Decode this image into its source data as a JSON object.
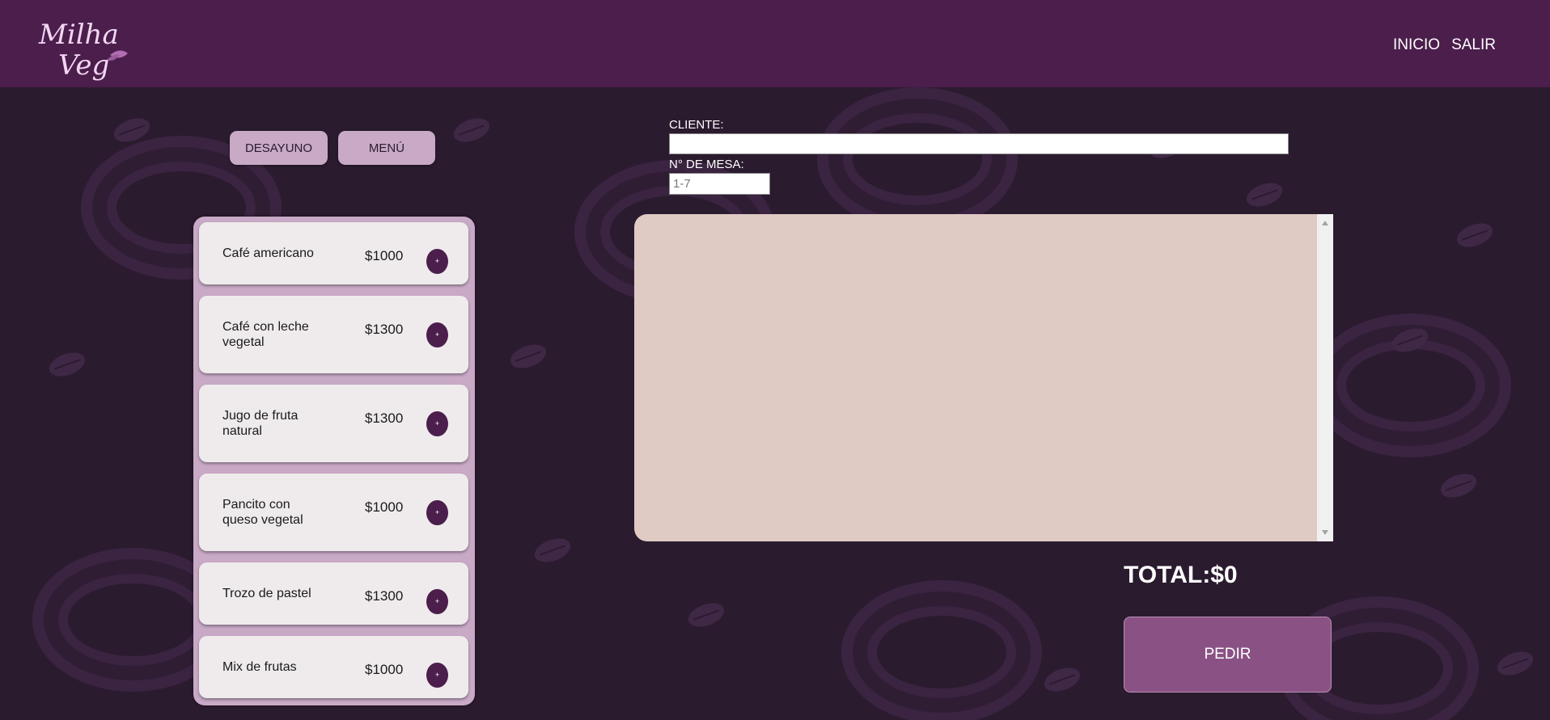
{
  "header": {
    "logo_text_line1": "Milha",
    "logo_text_line2": "Veg",
    "nav": {
      "inicio": "INICIO",
      "salir": "SALIR"
    }
  },
  "categories": {
    "desayuno": "DESAYUNO",
    "menu": "MENÚ"
  },
  "menu_items": [
    {
      "name": "Café americano",
      "price": "$1000",
      "add": "+"
    },
    {
      "name": "Café con leche vegetal",
      "price": "$1300",
      "add": "+"
    },
    {
      "name": "Jugo de fruta natural",
      "price": "$1300",
      "add": "+"
    },
    {
      "name": "Pancito con queso vegetal",
      "price": "$1000",
      "add": "+"
    },
    {
      "name": "Trozo de pastel",
      "price": "$1300",
      "add": "+"
    },
    {
      "name": "Mix de frutas",
      "price": "$1000",
      "add": "+"
    }
  ],
  "form": {
    "cliente_label": "CLIENTE:",
    "cliente_value": "",
    "mesa_label": "N° DE MESA:",
    "mesa_placeholder": "1-7",
    "mesa_value": ""
  },
  "order": {
    "total": "TOTAL:$0",
    "pedir_label": "PEDIR"
  },
  "colors": {
    "header_bg": "#4b1e4c",
    "page_bg": "#2b1b2f",
    "panel_bg": "#c8a9c6",
    "order_area_bg": "#dfcbc4",
    "pedir_bg": "#8a5284"
  }
}
